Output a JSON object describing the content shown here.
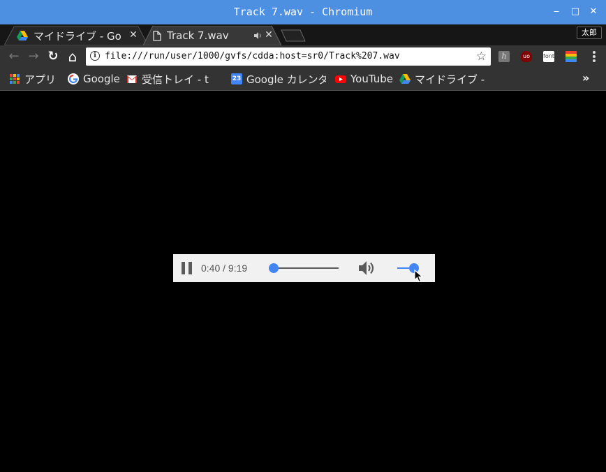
{
  "window": {
    "title": "Track 7.wav - Chromium",
    "minimize": "‒",
    "maximize": "□",
    "close": "✕"
  },
  "tabs": [
    {
      "title": "マイドライブ - Goo",
      "icon": "google-drive-icon",
      "active": false
    },
    {
      "title": "Track 7.wav",
      "icon": "file-icon",
      "active": true,
      "audio_icon": "speaker-icon"
    }
  ],
  "profile": {
    "name": "太郎"
  },
  "toolbar": {
    "back": "←",
    "forward": "→",
    "reload": "↻",
    "home": "⌂",
    "url": "file:///run/user/1000/gvfs/cdda:host=sr0/Track%207.wav",
    "info_glyph": "i",
    "star": "☆",
    "extensions": [
      {
        "name": "h-extension-icon",
        "label": "h",
        "color": "#777777"
      },
      {
        "name": "ublock-icon",
        "label": "uo",
        "color": "#800000"
      },
      {
        "name": "font-extension-icon",
        "label": "font",
        "color": "#ffffff"
      },
      {
        "name": "colorful-extension-icon",
        "label": "",
        "color": "#e94235"
      }
    ]
  },
  "bookmarks": {
    "items": [
      {
        "label": "アプリ",
        "icon": "apps-grid-icon"
      },
      {
        "label": "Google",
        "icon": "google-icon"
      },
      {
        "label": "受信トレイ - t",
        "icon": "gmail-icon"
      },
      {
        "label": "Google カレンダ",
        "icon": "calendar-icon",
        "icon_text": "23"
      },
      {
        "label": "YouTube",
        "icon": "youtube-icon"
      },
      {
        "label": "マイドライブ -",
        "icon": "google-drive-icon"
      }
    ],
    "more": "»"
  },
  "player": {
    "time": "0:40 / 9:19",
    "progress": 0.072,
    "volume": 1.0
  }
}
